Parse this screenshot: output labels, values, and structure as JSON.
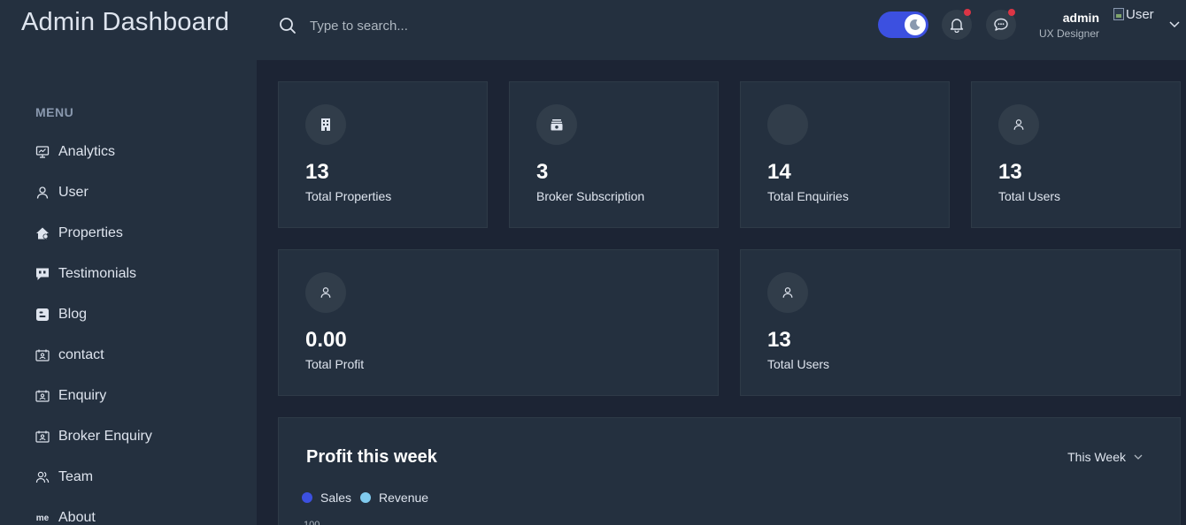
{
  "header": {
    "brand": "Admin Dashboard",
    "search_placeholder": "Type to search...",
    "user_name": "admin",
    "user_role": "UX Designer",
    "avatar_alt": "User"
  },
  "sidebar": {
    "menu_title": "MENU",
    "items": [
      {
        "label": "Analytics",
        "icon": "monitor-chart-icon"
      },
      {
        "label": "User",
        "icon": "user-icon"
      },
      {
        "label": "Properties",
        "icon": "house-icon"
      },
      {
        "label": "Testimonials",
        "icon": "quote-bubble-icon"
      },
      {
        "label": "Blog",
        "icon": "blogger-icon"
      },
      {
        "label": "contact",
        "icon": "contact-card-icon"
      },
      {
        "label": "Enquiry",
        "icon": "contact-card-icon"
      },
      {
        "label": "Broker Enquiry",
        "icon": "contact-card-icon"
      },
      {
        "label": "Team",
        "icon": "users-icon"
      },
      {
        "label": "About",
        "icon": "me-icon"
      }
    ],
    "about_icon_text": "me"
  },
  "stats": [
    {
      "value": "13",
      "label": "Total Properties",
      "icon": "building-icon"
    },
    {
      "value": "3",
      "label": "Broker Subscription",
      "icon": "ticket-icon"
    },
    {
      "value": "14",
      "label": "Total Enquiries",
      "icon": "blank-icon"
    },
    {
      "value": "13",
      "label": "Total Users",
      "icon": "user-icon"
    },
    {
      "value": "0.00",
      "label": "Total Profit",
      "icon": "user-icon"
    },
    {
      "value": "13",
      "label": "Total Users",
      "icon": "user-icon"
    }
  ],
  "chart": {
    "title": "Profit this week",
    "period": "This Week",
    "legend": [
      {
        "name": "Sales",
        "color": "#3c50e0"
      },
      {
        "name": "Revenue",
        "color": "#80caee"
      }
    ],
    "y_tick": "100"
  },
  "colors": {
    "accent": "#3c50e0",
    "notification": "#dc3545"
  }
}
